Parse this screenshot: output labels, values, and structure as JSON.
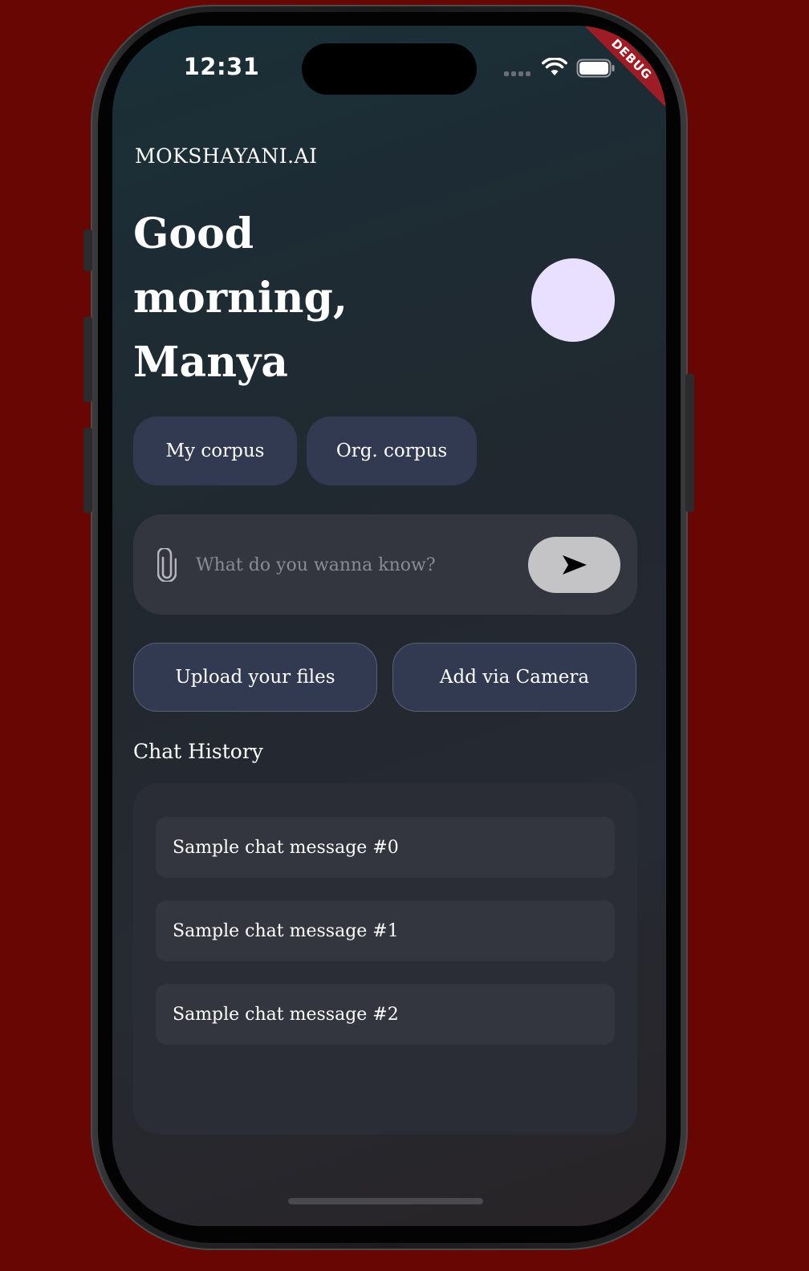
{
  "status_bar": {
    "time": "12:31",
    "icons": [
      "signal-icon",
      "wifi-icon",
      "battery-icon"
    ]
  },
  "debug_banner": "DEBUG",
  "app": {
    "brand": "MOKSHAYANI.AI",
    "greeting": {
      "line1": "Good",
      "line2": "morning,",
      "line3": "Manya"
    }
  },
  "corpus_chips": {
    "my_corpus": "My corpus",
    "org_corpus": "Org. corpus"
  },
  "search": {
    "placeholder": "What do you wanna know?",
    "value": ""
  },
  "actions": {
    "upload": "Upload your files",
    "camera": "Add via Camera"
  },
  "chat_history": {
    "title": "Chat History",
    "items": [
      {
        "label": "Sample chat message #0"
      },
      {
        "label": "Sample chat message #1"
      },
      {
        "label": "Sample chat message #2"
      }
    ]
  },
  "colors": {
    "background": "#680604",
    "chip": "#323a52",
    "avatar": "#e9e0ff",
    "send_button": "#c4c4c6",
    "panel": "#2a2d36"
  }
}
